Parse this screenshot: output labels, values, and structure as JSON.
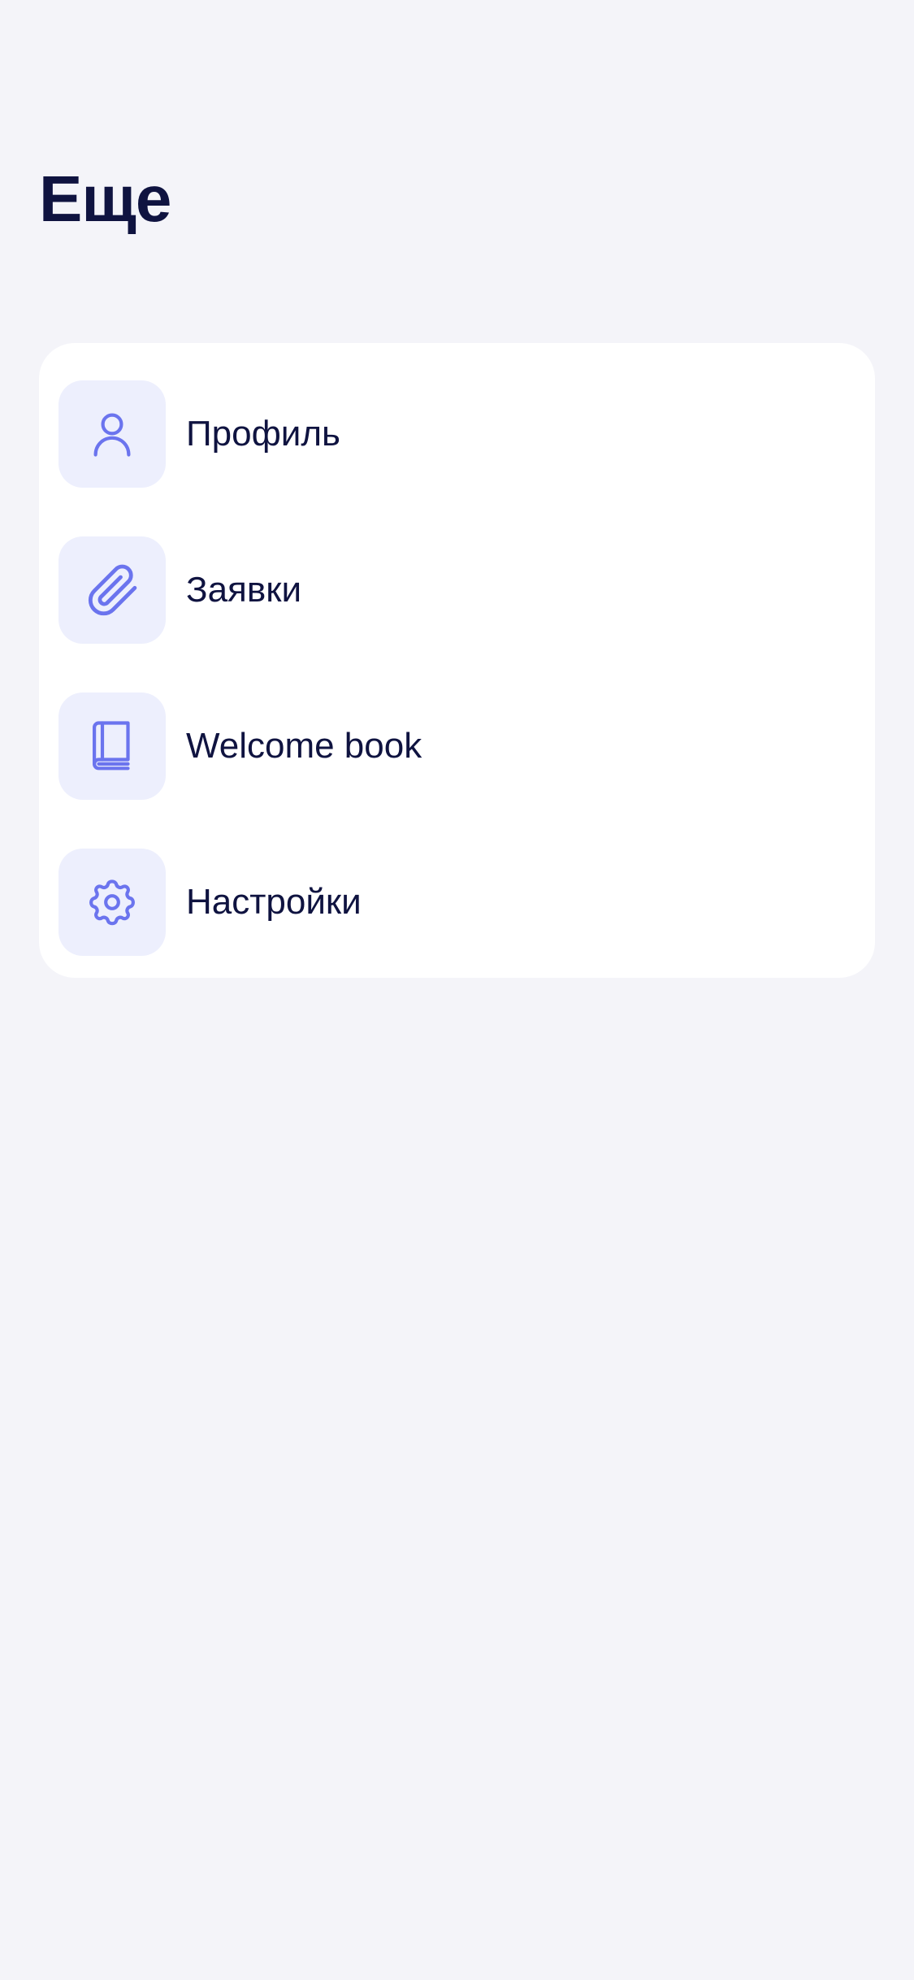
{
  "header": {
    "title": "Еще"
  },
  "menu": {
    "items": [
      {
        "label": "Профиль",
        "icon": "user-icon"
      },
      {
        "label": "Заявки",
        "icon": "paperclip-icon"
      },
      {
        "label": "Welcome book",
        "icon": "book-icon"
      },
      {
        "label": "Настройки",
        "icon": "gear-icon"
      }
    ]
  },
  "colors": {
    "background": "#F4F4F9",
    "card": "#FFFFFF",
    "icon_tile": "#EDEFFD",
    "accent": "#6B74EE",
    "text": "#0F1340"
  }
}
